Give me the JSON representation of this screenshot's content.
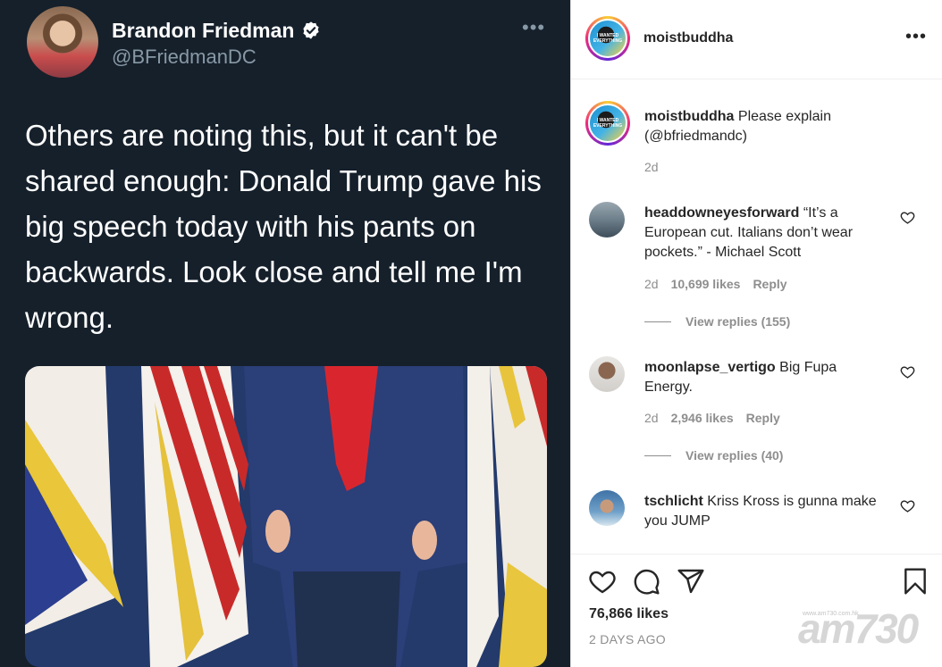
{
  "tweet": {
    "author_name": "Brandon Friedman",
    "author_handle": "@BFriedmanDC",
    "more_glyph": "•••",
    "text": "Others are noting this, but it can't be shared enough: Donald Trump gave his big speech today with his pants on backwards. Look close and tell me I'm wrong."
  },
  "instagram": {
    "header": {
      "username": "moistbuddha",
      "avatar_text": "I WANTED EVERYTHING",
      "more_glyph": "•••"
    },
    "caption": {
      "username": "moistbuddha",
      "text": "Please explain (@bfriedmandc)",
      "age": "2d"
    },
    "comments": [
      {
        "username": "headdowneyesforward",
        "text": "“It’s a European cut. Italians don’t wear pockets.” - Michael Scott",
        "age": "2d",
        "likes": "10,699 likes",
        "reply": "Reply",
        "view_replies": "View replies (155)"
      },
      {
        "username": "moonlapse_vertigo",
        "text": "Big Fupa Energy.",
        "age": "2d",
        "likes": "2,946 likes",
        "reply": "Reply",
        "view_replies": "View replies (40)"
      },
      {
        "username": "tschlicht",
        "text": "Kriss Kross is gunna make you JUMP"
      }
    ],
    "footer": {
      "likes": "76,866 likes",
      "posted": "2 DAYS AGO"
    },
    "icons": [
      "heart-icon",
      "comment-icon",
      "share-icon",
      "bookmark-icon"
    ]
  },
  "watermark": {
    "text": "am730",
    "small": "www.am730.com.hk"
  },
  "colors": {
    "tweet_bg": "#15202b",
    "tweet_secondary": "#8899a6",
    "ig_text": "#262626",
    "ig_secondary": "#8e8e8e",
    "ig_link": "#00376b"
  }
}
